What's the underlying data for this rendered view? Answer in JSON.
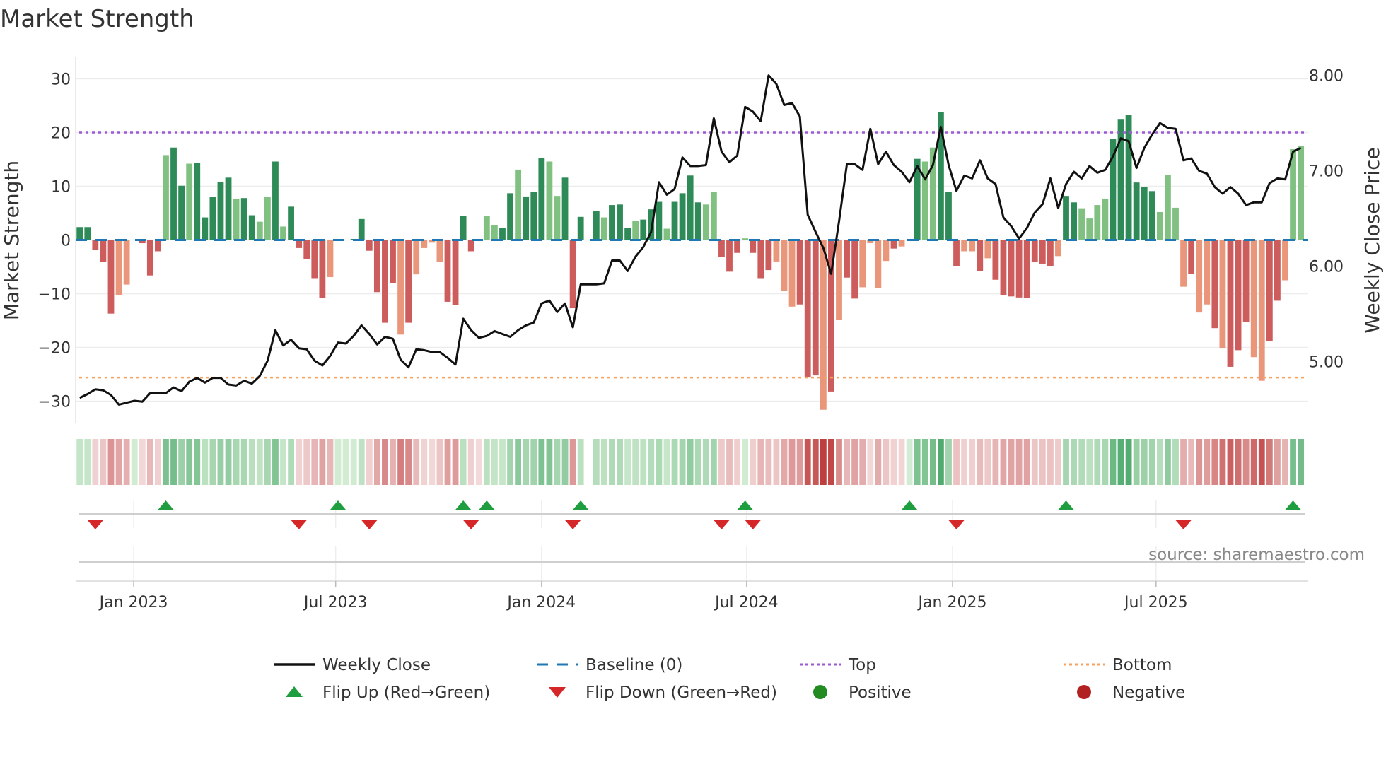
{
  "title": "Market Strength",
  "source": "source: sharemaestro.com",
  "colors": {
    "strong_green": "#2e8b57",
    "weak_green": "#80c080",
    "strong_red": "#cd5c5c",
    "weak_red": "#e9967a",
    "price": "#111111",
    "baseline": "#1f77b4",
    "top": "#9b59d6",
    "bottom": "#f4a460",
    "flip_up": "#1e9e3e",
    "flip_down": "#d62728",
    "positive": "#228b22",
    "negative": "#b22222"
  },
  "legend": [
    {
      "label": "Weekly Close",
      "icon": "solid-line"
    },
    {
      "label": "Baseline (0)",
      "icon": "dashed-line"
    },
    {
      "label": "Top",
      "icon": "dotted-line-purple"
    },
    {
      "label": "Bottom",
      "icon": "dotted-line-orange"
    },
    {
      "label": "Flip Up (Red→Green)",
      "icon": "triangle-up"
    },
    {
      "label": "Flip Down (Green→Red)",
      "icon": "triangle-down"
    },
    {
      "label": "Positive",
      "icon": "circle-green"
    },
    {
      "label": "Negative",
      "icon": "circle-red"
    }
  ],
  "chart_data": {
    "type": "bar",
    "title": "Market Strength",
    "ylabel": "Market Strength",
    "y2label": "Weekly Close Price",
    "ylim": [
      -34,
      34
    ],
    "y2lim": [
      4.36,
      8.19
    ],
    "yticks": [
      30,
      20,
      10,
      0,
      -10,
      -20,
      -30
    ],
    "ytick_labels": [
      "30",
      "20",
      "10",
      "0",
      "−10",
      "−20",
      "−30"
    ],
    "y2ticks": [
      8.0,
      7.0,
      6.0,
      5.0
    ],
    "y2tick_labels": [
      "8.00",
      "7.00",
      "6.00",
      "5.00"
    ],
    "xticks": [
      {
        "label": "Jan 2023",
        "week": 6.9
      },
      {
        "label": "Jul 2023",
        "week": 32.7
      },
      {
        "label": "Jan 2024",
        "week": 59.0
      },
      {
        "label": "Jul 2024",
        "week": 85.2
      },
      {
        "label": "Jan 2025",
        "week": 111.5
      },
      {
        "label": "Jul 2025",
        "week": 137.5
      }
    ],
    "top_level": 20,
    "bottom_level": -25.6,
    "baseline": 0,
    "strength": [
      2.4,
      2.4,
      -1.8,
      -4.1,
      -13.7,
      -10.3,
      -8.3,
      0,
      -0.6,
      -6.6,
      -2.1,
      15.8,
      17.2,
      10.1,
      14.2,
      14.3,
      4.2,
      8,
      10.8,
      11.6,
      7.7,
      7.8,
      4.6,
      3.4,
      8,
      14.6,
      2.5,
      6.2,
      -1.5,
      -3.5,
      -7.1,
      -10.8,
      -6.9,
      0.1,
      0,
      0.2,
      3.9,
      -2,
      -9.7,
      -15.4,
      -8,
      -17.6,
      -15.4,
      -6.4,
      -1.5,
      -0.5,
      -4.1,
      -11.5,
      -12.1,
      4.5,
      -2.1,
      -0.2,
      4.4,
      2.8,
      2.2,
      8.7,
      13.1,
      8.1,
      9,
      15.3,
      14.6,
      8.2,
      11.6,
      -12.7,
      4.3,
      0,
      5.4,
      4.2,
      6.5,
      6.6,
      2.2,
      3.5,
      3.8,
      5.7,
      7.1,
      2.1,
      7.1,
      8.7,
      12,
      7,
      6.6,
      9,
      -3.2,
      -5.9,
      -2.4,
      0.3,
      -2.4,
      -7.1,
      -5.6,
      -4,
      -9.5,
      -12.4,
      -12,
      -25.6,
      -25.2,
      -31.6,
      -28.2,
      -14.9,
      -7,
      -10.9,
      -8.8,
      -0.6,
      -9,
      -3.9,
      -1.6,
      -1.2,
      0.1,
      15.1,
      14.6,
      17.2,
      23.8,
      9,
      -4.9,
      -2.1,
      -2.1,
      -5.8,
      -3.4,
      -7.4,
      -10.3,
      -10.5,
      -10.7,
      -10.8,
      -4.1,
      -4.4,
      -4.9,
      -3,
      8.2,
      7,
      5.9,
      4,
      6.5,
      7.7,
      18.8,
      22.4,
      23.3,
      10.7,
      9.8,
      9.1,
      5.2,
      12.1,
      6,
      -8.7,
      -6.3,
      -13.5,
      -12,
      -16.4,
      -20.2,
      -23.6,
      -20.5,
      -15.3,
      -21.8,
      -26.2,
      -18.8,
      -11.3,
      -7.5,
      16.9,
      17.5
    ],
    "shade": "dddddllldddlddldddddlddlldldddddlddddddddldlllldddddllddldddlldddddldddldddlddddlldddldddllldddldlddlllldlldlldddlldlddddddddlddllllddddddlllldlldldddllddlllldd",
    "weekly_close": [
      4.62,
      4.66,
      4.71,
      4.7,
      4.65,
      4.55,
      4.57,
      4.59,
      4.58,
      4.67,
      4.67,
      4.67,
      4.73,
      4.69,
      4.79,
      4.83,
      4.78,
      4.83,
      4.83,
      4.76,
      4.75,
      4.8,
      4.77,
      4.85,
      5.01,
      5.33,
      5.17,
      5.23,
      5.14,
      5.13,
      5.01,
      4.96,
      5.06,
      5.2,
      5.19,
      5.27,
      5.38,
      5.29,
      5.18,
      5.26,
      5.24,
      5.02,
      4.94,
      5.13,
      5.12,
      5.1,
      5.1,
      5.04,
      4.97,
      5.45,
      5.33,
      5.25,
      5.27,
      5.32,
      5.29,
      5.26,
      5.33,
      5.38,
      5.41,
      5.61,
      5.64,
      5.52,
      5.61,
      5.36,
      5.81,
      5.81,
      5.81,
      5.82,
      6.06,
      6.06,
      5.95,
      6.1,
      6.2,
      6.36,
      6.88,
      6.75,
      6.81,
      7.14,
      7.05,
      7.05,
      7.06,
      7.55,
      7.2,
      7.09,
      7.16,
      7.67,
      7.62,
      7.52,
      8.0,
      7.91,
      7.69,
      7.71,
      7.57,
      6.54,
      6.36,
      6.19,
      5.92,
      6.47,
      7.07,
      7.07,
      7.01,
      7.44,
      7.07,
      7.2,
      7.06,
      6.99,
      6.88,
      7.05,
      6.91,
      7.06,
      7.46,
      7.06,
      6.79,
      6.95,
      6.92,
      7.11,
      6.92,
      6.86,
      6.51,
      6.42,
      6.29,
      6.4,
      6.56,
      6.65,
      6.92,
      6.61,
      6.86,
      6.99,
      6.92,
      7.05,
      6.98,
      7.01,
      7.15,
      7.34,
      7.31,
      7.03,
      7.24,
      7.38,
      7.5,
      7.45,
      7.44,
      7.11,
      7.13,
      7.0,
      6.97,
      6.83,
      6.76,
      6.83,
      6.76,
      6.64,
      6.67,
      6.67,
      6.87,
      6.92,
      6.91,
      7.2,
      7.24
    ],
    "flip_up_weeks": [
      11,
      33,
      49,
      52,
      64,
      85,
      106,
      126,
      155
    ],
    "flip_down_weeks": [
      2,
      28,
      37,
      50,
      63,
      82,
      86,
      112,
      141
    ],
    "heat_gap_weeks": [
      65
    ]
  }
}
